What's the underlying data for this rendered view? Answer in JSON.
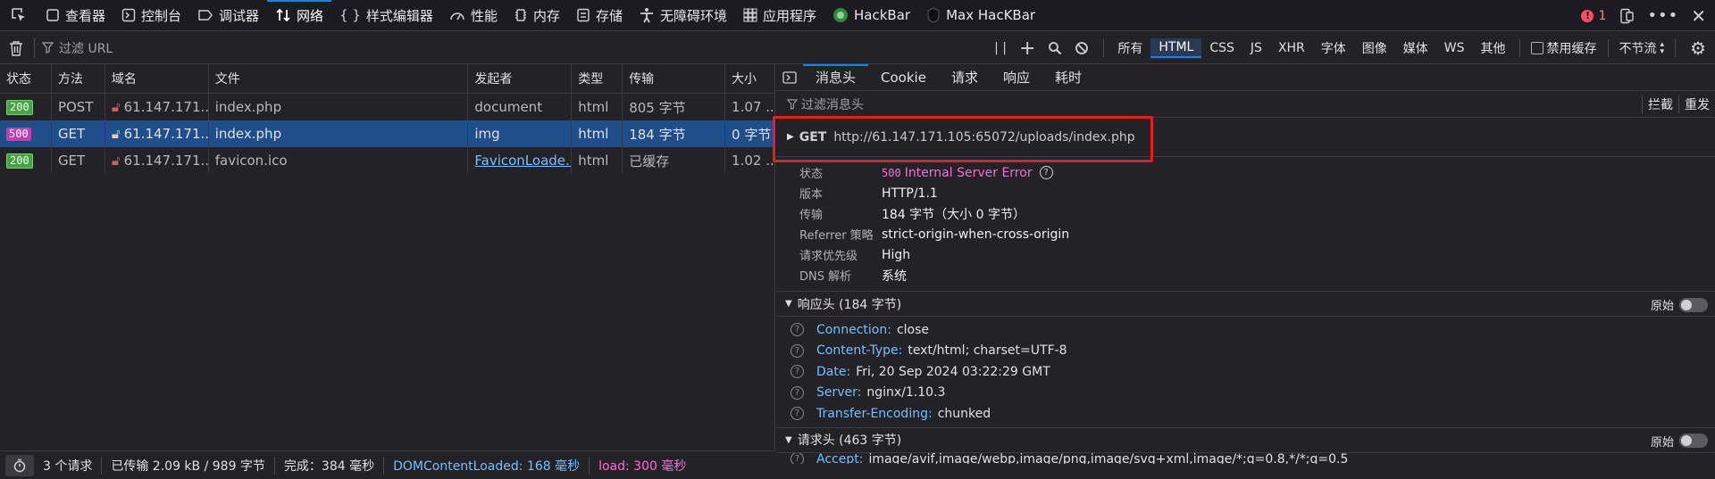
{
  "toolbar": {
    "tabs": [
      {
        "label": "查看器",
        "icon": "inspector-icon"
      },
      {
        "label": "控制台",
        "icon": "console-icon"
      },
      {
        "label": "调试器",
        "icon": "debugger-icon"
      },
      {
        "label": "网络",
        "icon": "network-icon"
      },
      {
        "label": "样式编辑器",
        "icon": "style-editor-icon"
      },
      {
        "label": "性能",
        "icon": "performance-icon"
      },
      {
        "label": "内存",
        "icon": "memory-icon"
      },
      {
        "label": "存储",
        "icon": "storage-icon"
      },
      {
        "label": "无障碍环境",
        "icon": "accessibility-icon"
      },
      {
        "label": "应用程序",
        "icon": "application-icon"
      },
      {
        "label": "HackBar",
        "icon": "hackbar-icon"
      },
      {
        "label": "Max HacKBar",
        "icon": "max-hackbar-icon"
      }
    ],
    "error_count": "1"
  },
  "filterbar": {
    "placeholder": "过滤 URL",
    "types": [
      "所有",
      "HTML",
      "CSS",
      "JS",
      "XHR",
      "字体",
      "图像",
      "媒体",
      "WS",
      "其他"
    ],
    "disable_cache": "禁用缓存",
    "throttle": "不节流"
  },
  "reqlist": {
    "headers": [
      "状态",
      "方法",
      "域名",
      "文件",
      "发起者",
      "类型",
      "传输",
      "大小"
    ],
    "rows": [
      {
        "status": "200",
        "method": "POST",
        "domain": "61.147.171...",
        "file": "index.php",
        "initiator": "document",
        "type": "html",
        "transfer": "805 字节",
        "size": "1.07 ..."
      },
      {
        "status": "500",
        "method": "GET",
        "domain": "61.147.171...",
        "file": "index.php",
        "initiator": "img",
        "type": "html",
        "transfer": "184 字节",
        "size": "0 字节"
      },
      {
        "status": "200",
        "method": "GET",
        "domain": "61.147.171...",
        "file": "favicon.ico",
        "initiator": "FaviconLoade...",
        "type": "html",
        "transfer": "已缓存",
        "size": "1.02 ..."
      }
    ]
  },
  "statusbar": {
    "requests": "3 个请求",
    "transferred": "已传输 2.09 kB / 989 字节",
    "finish": "完成：384 毫秒",
    "dcl": "DOMContentLoaded: 168 毫秒",
    "load": "load: 300 毫秒"
  },
  "details": {
    "tabs": [
      "消息头",
      "Cookie",
      "请求",
      "响应",
      "耗时"
    ],
    "filter_placeholder": "过滤消息头",
    "block": "拦截",
    "resend": "重发",
    "method": "GET",
    "url": "http://61.147.171.105:65072/uploads/index.php",
    "summary": [
      {
        "k": "状态",
        "v": "Internal Server Error",
        "code": "500"
      },
      {
        "k": "版本",
        "v": "HTTP/1.1"
      },
      {
        "k": "传输",
        "v": "184 字节（大小 0 字节）"
      },
      {
        "k": "Referrer 策略",
        "v": "strict-origin-when-cross-origin"
      },
      {
        "k": "请求优先级",
        "v": "High"
      },
      {
        "k": "DNS 解析",
        "v": "系统"
      }
    ],
    "response_headers_title": "响应头 (184 字节)",
    "raw_label": "原始",
    "response_headers": [
      {
        "n": "Connection:",
        "v": "close"
      },
      {
        "n": "Content-Type:",
        "v": "text/html; charset=UTF-8"
      },
      {
        "n": "Date:",
        "v": "Fri, 20 Sep 2024 03:22:29 GMT"
      },
      {
        "n": "Server:",
        "v": "nginx/1.10.3"
      },
      {
        "n": "Transfer-Encoding:",
        "v": "chunked"
      }
    ],
    "request_headers_title": "请求头 (463 字节)",
    "request_headers": [
      {
        "n": "Accept:",
        "v": "image/avif,image/webp,image/png,image/svg+xml,image/*;q=0.8,*/*;q=0.5"
      }
    ]
  },
  "colors": {
    "accent": "#0a84ff",
    "highlight_box": "#e0201c",
    "error": "#c23fb1"
  }
}
